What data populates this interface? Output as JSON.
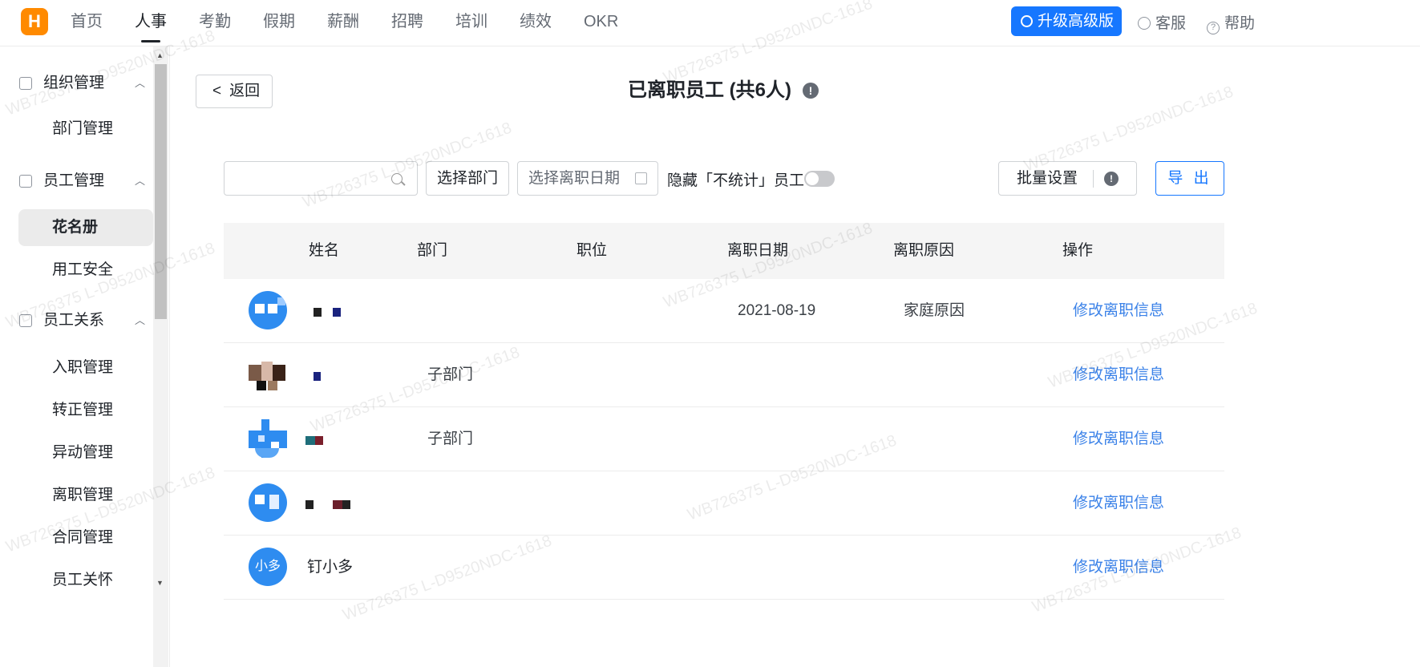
{
  "app": {
    "logo_letter": "H",
    "brand_color": "#ff8a00",
    "accent": "#1677ff"
  },
  "topnav": {
    "items": [
      "首页",
      "人事",
      "考勤",
      "假期",
      "薪酬",
      "招聘",
      "培训",
      "绩效",
      "OKR"
    ],
    "active": "人事",
    "upgrade_label": "升级高级版",
    "service_label": "客服",
    "help_label": "帮助"
  },
  "sidebar": {
    "groups": [
      {
        "label": "组织管理",
        "items": [
          "部门管理"
        ]
      },
      {
        "label": "员工管理",
        "items": [
          "花名册",
          "用工安全"
        ]
      },
      {
        "label": "员工关系",
        "items": [
          "入职管理",
          "转正管理",
          "异动管理",
          "离职管理",
          "合同管理",
          "员工关怀"
        ]
      }
    ],
    "active_item": "花名册"
  },
  "page": {
    "back_label": "返回",
    "title": "已离职员工 (共6人)"
  },
  "filters": {
    "search_placeholder": "",
    "dept_select": "选择部门",
    "date_select": "选择离职日期",
    "hide_label": "隐藏「不统计」员工",
    "hide_enabled": false,
    "batch_label": "批量设置",
    "export_label": "导 出"
  },
  "table": {
    "columns": [
      "姓名",
      "部门",
      "职位",
      "离职日期",
      "离职原因",
      "操作"
    ],
    "rows": [
      {
        "name": "",
        "avatar_text": "",
        "department": "",
        "position": "",
        "leave_date": "2021-08-19",
        "reason": "家庭原因",
        "action": "修改离职信息"
      },
      {
        "name": "",
        "avatar_text": "",
        "department": "子部门",
        "position": "",
        "leave_date": "",
        "reason": "",
        "action": "修改离职信息"
      },
      {
        "name": "",
        "avatar_text": "",
        "department": "子部门",
        "position": "",
        "leave_date": "",
        "reason": "",
        "action": "修改离职信息"
      },
      {
        "name": "",
        "avatar_text": "",
        "department": "",
        "position": "",
        "leave_date": "",
        "reason": "",
        "action": "修改离职信息"
      },
      {
        "name": "钉小多",
        "avatar_text": "小多",
        "department": "",
        "position": "",
        "leave_date": "",
        "reason": "",
        "action": "修改离职信息"
      }
    ]
  },
  "watermark": "WB726375 L-D9520NDC-1618"
}
